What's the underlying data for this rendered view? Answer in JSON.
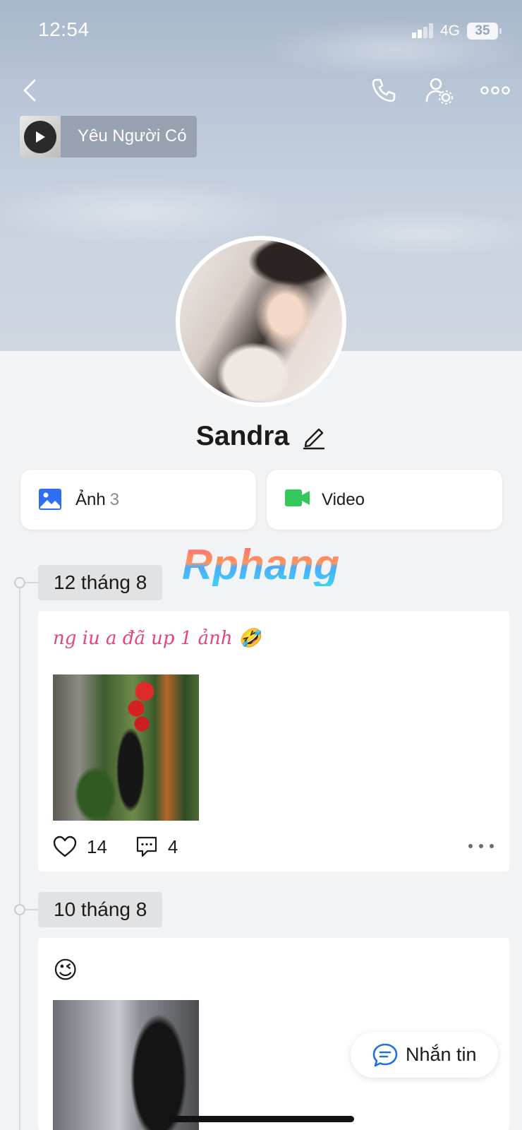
{
  "status_bar": {
    "time": "12:54",
    "network": "4G",
    "battery": "35"
  },
  "header": {
    "icons": [
      "back-icon",
      "phone-icon",
      "user-settings-icon",
      "more-icon"
    ]
  },
  "music": {
    "title": "Yêu Người Có",
    "icon": "play-icon"
  },
  "profile": {
    "name": "Sandra",
    "edit_icon": "pencil-icon"
  },
  "media": {
    "photos_label": "Ảnh",
    "photos_count": "3",
    "video_label": "Video",
    "photo_icon_color": "#2f6ef2",
    "video_icon_color": "#34c759"
  },
  "watermark": "Rphang",
  "timeline": [
    {
      "date": "12 tháng 8",
      "caption": "ng iu a đã up 1 ảnh 🤣",
      "likes": "14",
      "comments": "4"
    },
    {
      "date": "10 tháng 8",
      "caption": "😉"
    }
  ],
  "message_button": {
    "label": "Nhắn tin",
    "icon": "chat-icon",
    "icon_color": "#1f6fe5"
  },
  "colors": {
    "caption_pink": "#e6457a",
    "background": "#f2f3f5"
  }
}
